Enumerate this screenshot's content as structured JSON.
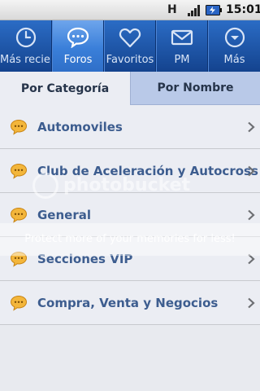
{
  "status_bar": {
    "network": "H",
    "time": "15:01"
  },
  "tabs": [
    {
      "label": "Más reciente",
      "icon": "clock-icon",
      "active": false
    },
    {
      "label": "Foros",
      "icon": "chat-bubble-icon",
      "active": true
    },
    {
      "label": "Favoritos",
      "icon": "heart-icon",
      "active": false
    },
    {
      "label": "PM",
      "icon": "envelope-icon",
      "active": false
    },
    {
      "label": "Más",
      "icon": "chevron-down-circle-icon",
      "active": false
    }
  ],
  "segments": {
    "by_category": "Por Categoría",
    "by_name": "Por Nombre"
  },
  "forums": [
    {
      "label": "Automoviles"
    },
    {
      "label": "Club de Aceleración y Autocross"
    },
    {
      "label": "General"
    },
    {
      "label": "Secciones VIP"
    },
    {
      "label": "Compra, Venta y Negocios"
    }
  ],
  "watermark": {
    "logo": "photobucket",
    "text": "Protect more of your memories for less!"
  },
  "colors": {
    "tab_bar": "#1d57ab",
    "tab_active": "#4f8fe0",
    "forum_label": "#3d5d8f",
    "segment_inactive": "#b9c9e8"
  }
}
